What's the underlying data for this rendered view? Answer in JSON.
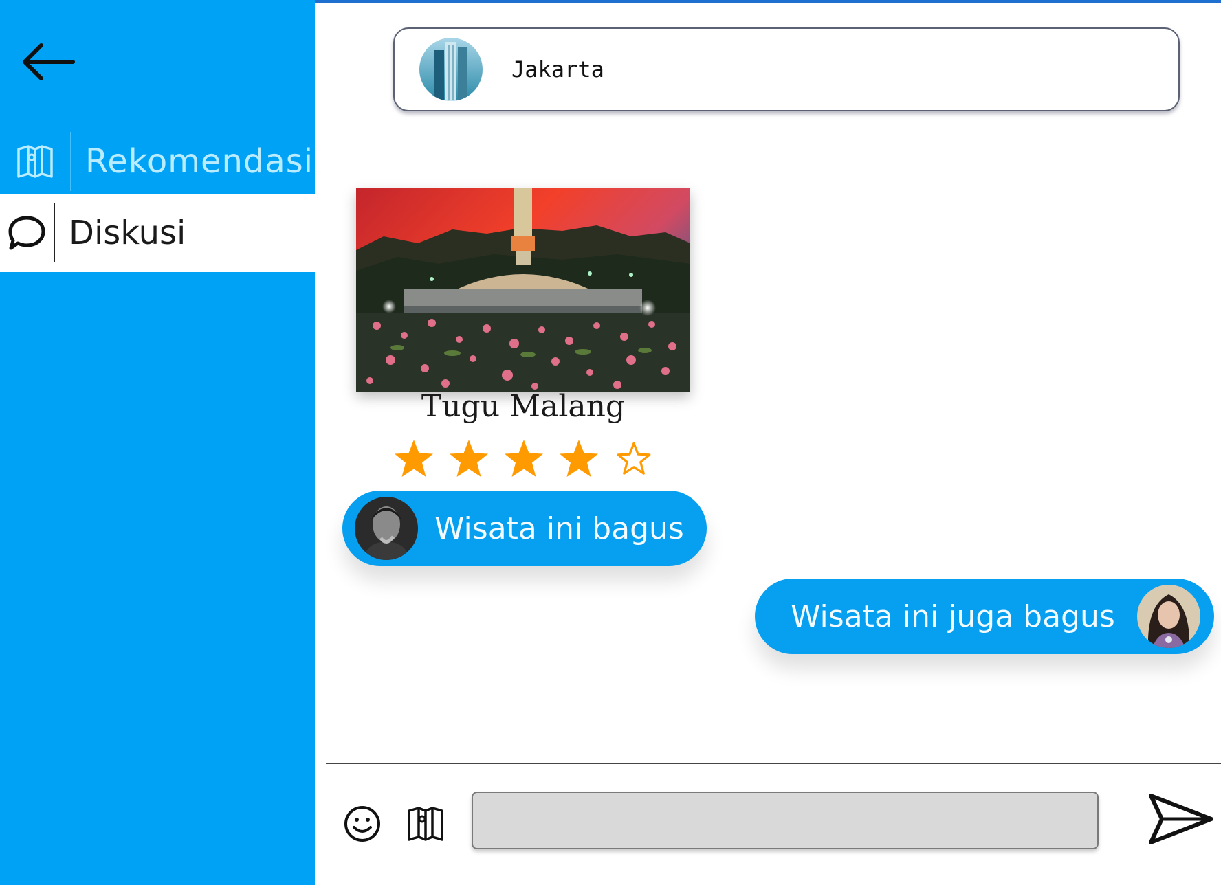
{
  "sidebar": {
    "back_icon": "arrow-left-icon",
    "items": [
      {
        "label": "Rekomendasi",
        "icon": "map-icon",
        "active": false
      },
      {
        "label": "Diskusi",
        "icon": "chat-bubble-icon",
        "active": true
      }
    ]
  },
  "header": {
    "city_name": "Jakarta",
    "avatar_icon": "city-skyline-photo"
  },
  "place": {
    "name": "Tugu Malang",
    "rating": 4,
    "rating_max": 5
  },
  "messages": [
    {
      "text": "Wisata ini bagus",
      "side": "left",
      "avatar": "man-avatar"
    },
    {
      "text": "Wisata ini juga bagus",
      "side": "right",
      "avatar": "woman-avatar"
    }
  ],
  "composer": {
    "input_value": "",
    "input_placeholder": "",
    "emoji_icon": "smiley-icon",
    "map_icon": "map-icon",
    "send_icon": "send-icon"
  },
  "colors": {
    "sidebar_bg": "#00a2f5",
    "bubble_bg": "#079ff0",
    "star": "#ff9a00",
    "top_line": "#1f6fd1"
  }
}
